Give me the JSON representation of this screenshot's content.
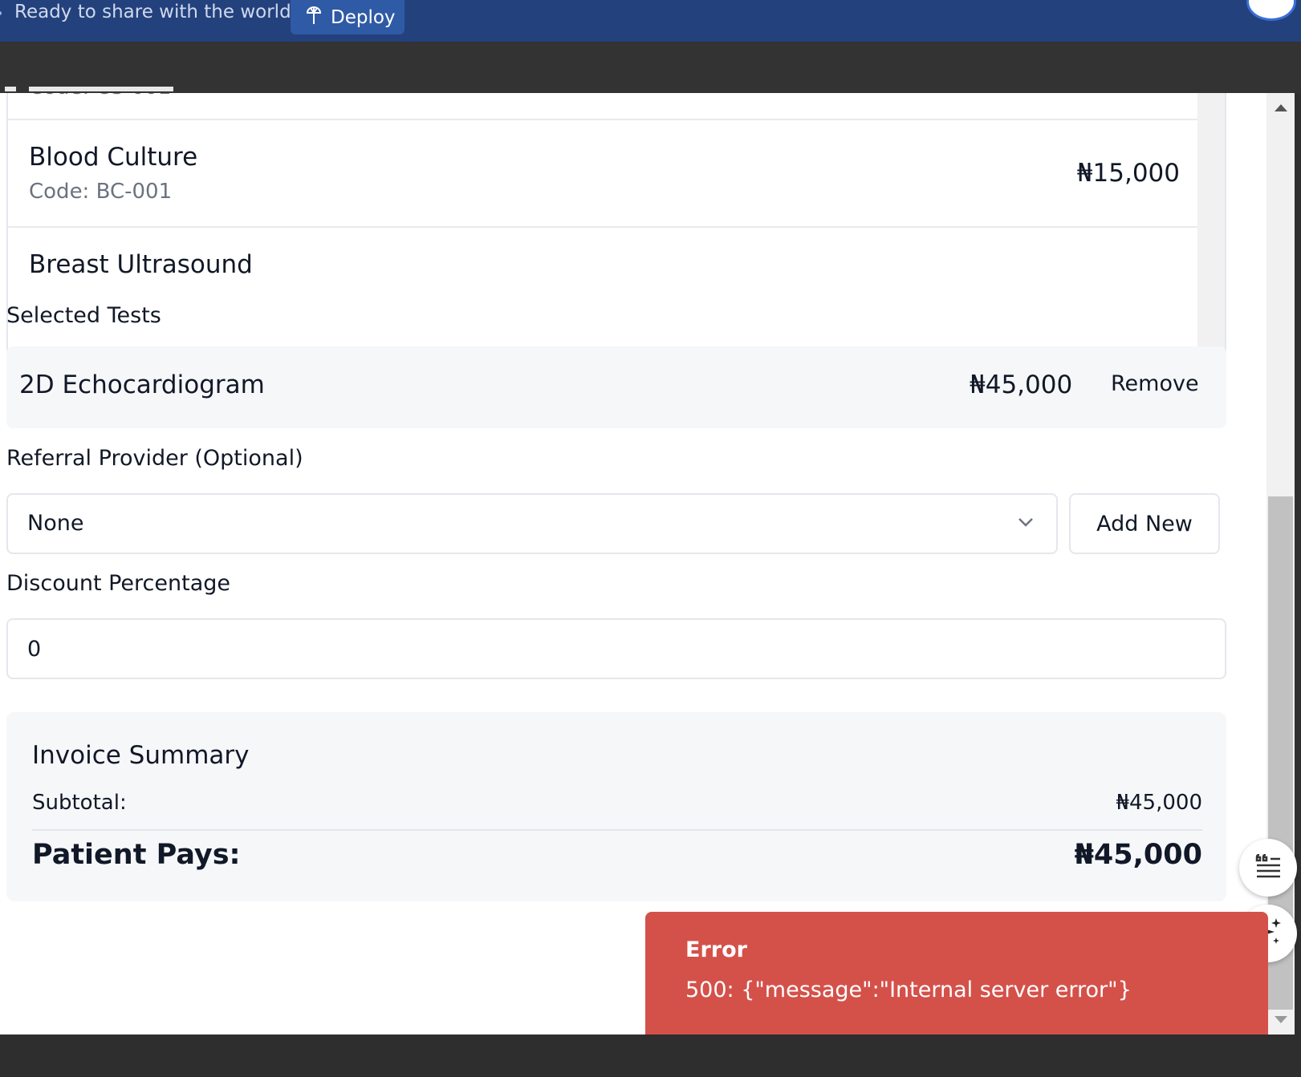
{
  "banner": {
    "prompt": "Ready to share with the world?",
    "deploy_label": "Deploy"
  },
  "test_list": {
    "items": [
      {
        "name": "Blood Culture",
        "code": "Code: BC-001",
        "price": "₦15,000"
      },
      {
        "name": "Breast Ultrasound"
      }
    ]
  },
  "selected_tests": {
    "label": "Selected Tests",
    "items": [
      {
        "name": "2D Echocardiogram",
        "price": "₦45,000",
        "remove_label": "Remove"
      }
    ]
  },
  "referral": {
    "label": "Referral Provider (Optional)",
    "selected": "None",
    "add_new_label": "Add New"
  },
  "discount": {
    "label": "Discount Percentage",
    "value": "0"
  },
  "summary": {
    "title": "Invoice Summary",
    "subtotal_label": "Subtotal:",
    "subtotal_value": "₦45,000",
    "patient_pays_label": "Patient Pays:",
    "patient_pays_value": "₦45,000"
  },
  "toast": {
    "title": "Error",
    "message": "500: {\"message\":\"Internal server error\"}",
    "color": "#d4514a"
  },
  "colors": {
    "banner_bg": "#23417c",
    "deploy_bg": "#2f5aa5",
    "accent": "#3a6fd8"
  },
  "icons": [
    "deploy-icon",
    "chevron-down-icon",
    "quote-list-icon",
    "sparkle-icon"
  ]
}
